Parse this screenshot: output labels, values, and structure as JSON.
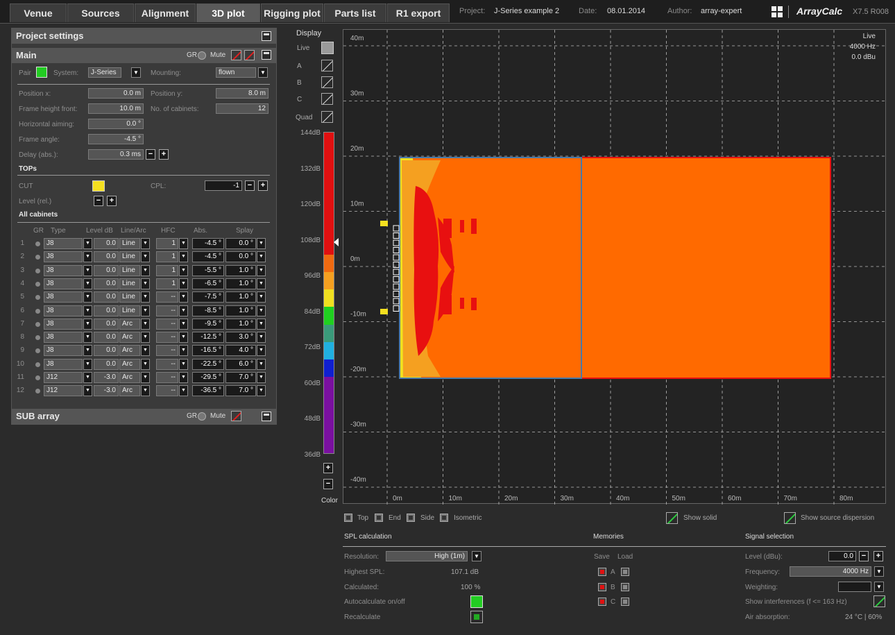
{
  "tabs": [
    "Venue",
    "Sources",
    "Alignment",
    "3D plot",
    "Rigging plot",
    "Parts list",
    "R1 export"
  ],
  "active_tab": "3D plot",
  "meta": {
    "project_label": "Project:",
    "project": "J-Series example 2",
    "date_label": "Date:",
    "date": "08.01.2014",
    "author_label": "Author:",
    "author": "array-expert",
    "app": "ArrayCalc",
    "version": "X7.5 R008"
  },
  "project_settings": {
    "title": "Project settings"
  },
  "main": {
    "title": "Main",
    "gr": "GR",
    "mute": "Mute",
    "pair_label": "Pair",
    "system_label": "System:",
    "system_value": "J-Series",
    "mounting_label": "Mounting:",
    "mounting_value": "flown",
    "pos_x_label": "Position x:",
    "pos_x": "0.0 m",
    "pos_y_label": "Position y:",
    "pos_y": "8.0 m",
    "frame_height_label": "Frame height front:",
    "frame_height": "10.0 m",
    "num_cab_label": "No. of cabinets:",
    "num_cab": "12",
    "h_aim_label": "Horizontal aiming:",
    "h_aim": "0.0 °",
    "frame_angle_label": "Frame angle:",
    "frame_angle": "-4.5 °",
    "delay_label": "Delay (abs.):",
    "delay": "0.3 ms",
    "tops_label": "TOPs",
    "cut_label": "CUT",
    "cpl_label": "CPL:",
    "cpl": "-1",
    "level_rel_label": "Level (rel.)",
    "all_cab_label": "All cabinets",
    "columns": [
      "GR",
      "Type",
      "Level dB",
      "Line/Arc",
      "HFC",
      "Abs.",
      "Splay"
    ],
    "rows": [
      {
        "n": "1",
        "type": "J8",
        "level": "0.0",
        "la": "Line",
        "hfc": "1",
        "abs": "-4.5 °",
        "splay": "0.0 °"
      },
      {
        "n": "2",
        "type": "J8",
        "level": "0.0",
        "la": "Line",
        "hfc": "1",
        "abs": "-4.5 °",
        "splay": "0.0 °"
      },
      {
        "n": "3",
        "type": "J8",
        "level": "0.0",
        "la": "Line",
        "hfc": "1",
        "abs": "-5.5 °",
        "splay": "1.0 °"
      },
      {
        "n": "4",
        "type": "J8",
        "level": "0.0",
        "la": "Line",
        "hfc": "1",
        "abs": "-6.5 °",
        "splay": "1.0 °"
      },
      {
        "n": "5",
        "type": "J8",
        "level": "0.0",
        "la": "Line",
        "hfc": "--",
        "abs": "-7.5 °",
        "splay": "1.0 °"
      },
      {
        "n": "6",
        "type": "J8",
        "level": "0.0",
        "la": "Line",
        "hfc": "--",
        "abs": "-8.5 °",
        "splay": "1.0 °"
      },
      {
        "n": "7",
        "type": "J8",
        "level": "0.0",
        "la": "Arc",
        "hfc": "--",
        "abs": "-9.5 °",
        "splay": "1.0 °"
      },
      {
        "n": "8",
        "type": "J8",
        "level": "0.0",
        "la": "Arc",
        "hfc": "--",
        "abs": "-12.5 °",
        "splay": "3.0 °"
      },
      {
        "n": "9",
        "type": "J8",
        "level": "0.0",
        "la": "Arc",
        "hfc": "--",
        "abs": "-16.5 °",
        "splay": "4.0 °"
      },
      {
        "n": "10",
        "type": "J8",
        "level": "0.0",
        "la": "Arc",
        "hfc": "--",
        "abs": "-22.5 °",
        "splay": "6.0 °"
      },
      {
        "n": "11",
        "type": "J12",
        "level": "-3.0",
        "la": "Arc",
        "hfc": "--",
        "abs": "-29.5 °",
        "splay": "7.0 °"
      },
      {
        "n": "12",
        "type": "J12",
        "level": "-3.0",
        "la": "Arc",
        "hfc": "--",
        "abs": "-36.5 °",
        "splay": "7.0 °"
      }
    ]
  },
  "sub_array": {
    "title": "SUB array",
    "gr": "GR",
    "mute": "Mute"
  },
  "display": {
    "title": "Display",
    "live": "Live",
    "a": "A",
    "b": "B",
    "c": "C",
    "quad": "Quad",
    "color": "Color"
  },
  "scale": {
    "labels": [
      "144dB",
      "132dB",
      "120dB",
      "108dB",
      "96dB",
      "84dB",
      "72dB",
      "60dB",
      "48dB",
      "36dB"
    ],
    "colors": [
      "#e01010",
      "#e01010",
      "#e01010",
      "#e01010",
      "#f06a10",
      "#f5a020",
      "#f0e020",
      "#20d020",
      "#3a9a7a",
      "#20b0e0",
      "#1020d0",
      "#7a10a0",
      "#7a10a0"
    ]
  },
  "plot": {
    "y_labels": [
      "40m",
      "30m",
      "20m",
      "10m",
      "0m",
      "-10m",
      "-20m",
      "-30m",
      "-40m"
    ],
    "x_labels": [
      "0m",
      "10m",
      "20m",
      "30m",
      "40m",
      "50m",
      "60m",
      "70m",
      "80m"
    ],
    "live": "Live",
    "freq": "4000 Hz",
    "dbu": "0.0 dBu"
  },
  "views": {
    "top": "Top",
    "end": "End",
    "side": "Side",
    "iso": "Isometric",
    "show_solid": "Show solid",
    "show_disp": "Show source dispersion"
  },
  "spl": {
    "title": "SPL calculation",
    "res_label": "Resolution:",
    "res_value": "High (1m)",
    "highest_label": "Highest SPL:",
    "highest": "107.1 dB",
    "calc_label": "Calculated:",
    "calc": "100 %",
    "auto_label": "Autocalculate on/off",
    "recalc_label": "Recalculate"
  },
  "memories": {
    "title": "Memories",
    "save": "Save",
    "load": "Load",
    "a": "A",
    "b": "B",
    "c": "C"
  },
  "signal": {
    "title": "Signal selection",
    "level_label": "Level (dBu):",
    "level": "0.0",
    "freq_label": "Frequency:",
    "freq": "4000 Hz",
    "weight_label": "Weighting:",
    "weight": "",
    "interf_label": "Show interferences (f <= 163 Hz)",
    "air_label": "Air absorption:",
    "air": "24 °C | 60%"
  },
  "colors": {
    "accent_green": "#22cc22",
    "spl_orange": "#ff6a00",
    "spl_red": "#e81010",
    "spl_yellow": "#f0e020"
  }
}
